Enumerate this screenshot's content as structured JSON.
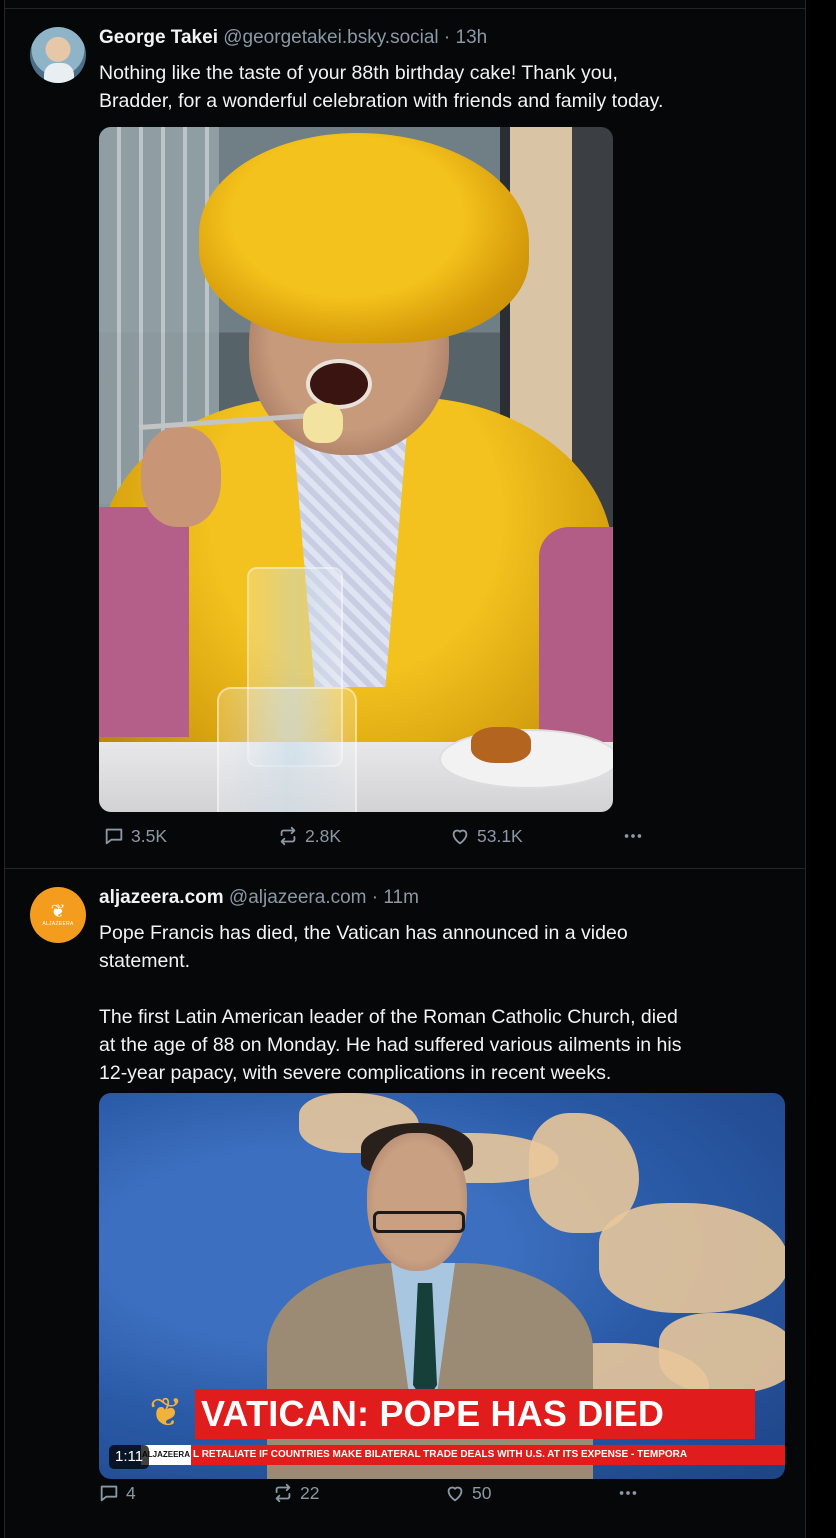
{
  "posts": [
    {
      "author_name": "George Takei",
      "handle": "@georgetakei.bsky.social",
      "separator": "·",
      "time": "13h",
      "text": "Nothing like the taste of your 88th birthday cake! Thank you,\nBradder, for a wonderful celebration with friends and family today.",
      "stats": {
        "replies": "3.5K",
        "reposts": "2.8K",
        "likes": "53.1K"
      }
    },
    {
      "author_name": "aljazeera.com",
      "handle": "@aljazeera.com",
      "separator": "·",
      "time": "11m",
      "text": "Pope Francis has died, the Vatican has announced in a video\nstatement.\n\nThe first Latin American leader of the Roman Catholic Church, died\nat the age of 88 on Monday. He had suffered various ailments in his\n12-year papacy, with severe complications in recent weeks.",
      "video": {
        "headline": "VATICAN: POPE HAS DIED",
        "ticker": "L RETALIATE IF COUNTRIES MAKE BILATERAL TRADE DEALS WITH U.S. AT ITS EXPENSE  -  TEMPORA",
        "logo_text": "ALJAZEERA",
        "duration": "1:11"
      },
      "stats": {
        "replies": "4",
        "reposts": "22",
        "likes": "50"
      }
    }
  ],
  "icons": {
    "reply": "reply-icon",
    "repost": "repost-icon",
    "like": "heart-icon",
    "more": "more-icon"
  },
  "colors": {
    "background": "#000000",
    "text": "#f1f3f5",
    "muted": "#8b98a5",
    "border": "#22262b",
    "banner_red": "#e11c1c",
    "aljazeera_orange": "#f39c1e"
  }
}
